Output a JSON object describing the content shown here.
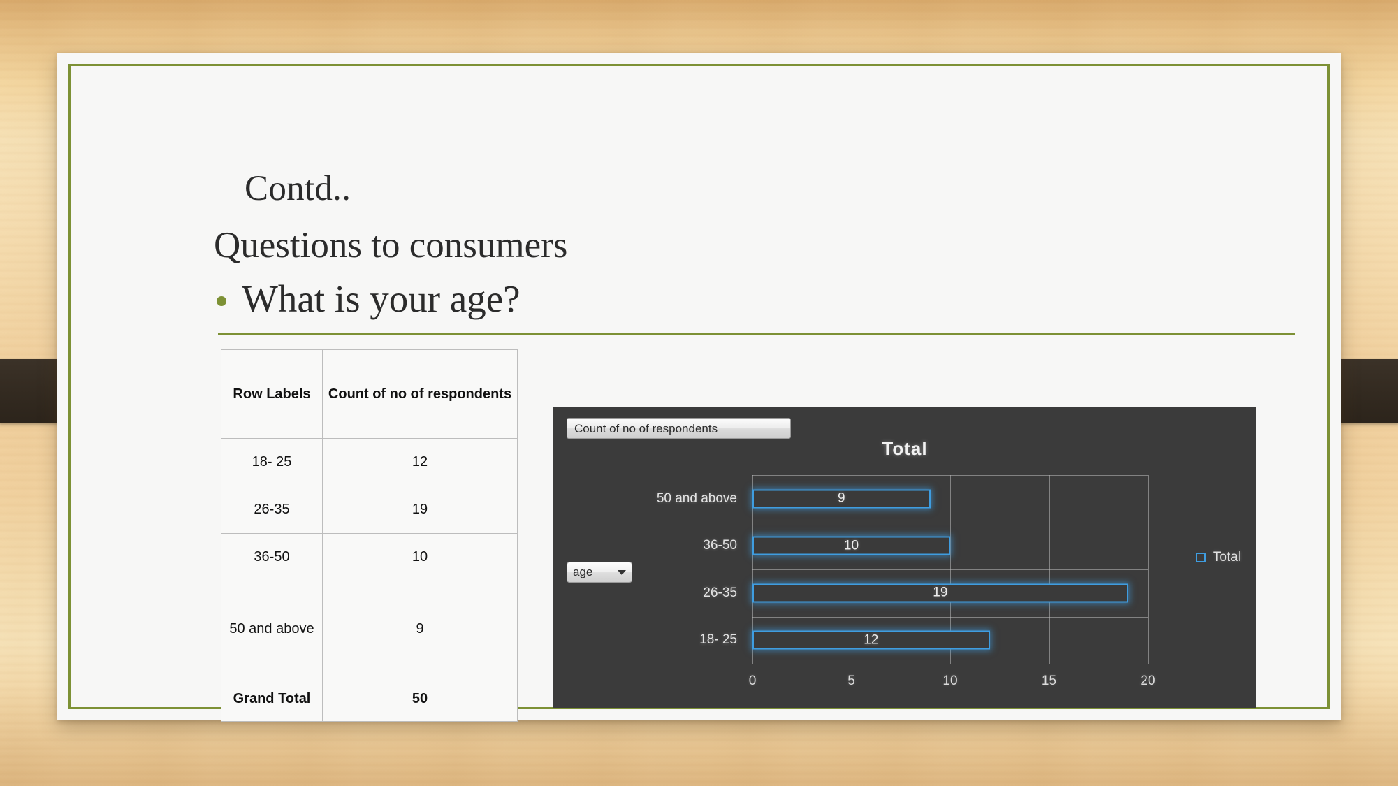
{
  "slide": {
    "title_contd": "Contd..",
    "subtitle": "Questions to consumers",
    "bullet": "What is your age?"
  },
  "pivot_table": {
    "headers": [
      "Row Labels",
      "Count of no of respondents"
    ],
    "rows": [
      {
        "label": "18- 25",
        "value": "12"
      },
      {
        "label": "26-35",
        "value": "19"
      },
      {
        "label": "36-50",
        "value": "10"
      },
      {
        "label": "50 and above",
        "value": "9"
      }
    ],
    "total_row": {
      "label": "Grand Total",
      "value": "50"
    }
  },
  "chart": {
    "field_button_label": "Count of no of respondents",
    "axis_field_button_label": "age",
    "legend_label": "Total"
  },
  "chart_data": {
    "type": "bar",
    "orientation": "horizontal",
    "title": "Total",
    "categories": [
      "18- 25",
      "26-35",
      "36-50",
      "50 and above"
    ],
    "values": [
      12,
      19,
      10,
      9
    ],
    "series": [
      {
        "name": "Total",
        "values": [
          12,
          19,
          10,
          9
        ]
      }
    ],
    "xlabel": "",
    "ylabel": "",
    "xlim": [
      0,
      20
    ],
    "xticks": [
      "0",
      "5",
      "10",
      "15",
      "20"
    ],
    "grid": true,
    "legend_position": "right",
    "data_labels": [
      "12",
      "19",
      "10",
      "9"
    ],
    "colors": {
      "bar_outline": "#3f9de0",
      "bar_fill": "#3a3a3a",
      "plot_background": "#3b3b3b"
    }
  }
}
